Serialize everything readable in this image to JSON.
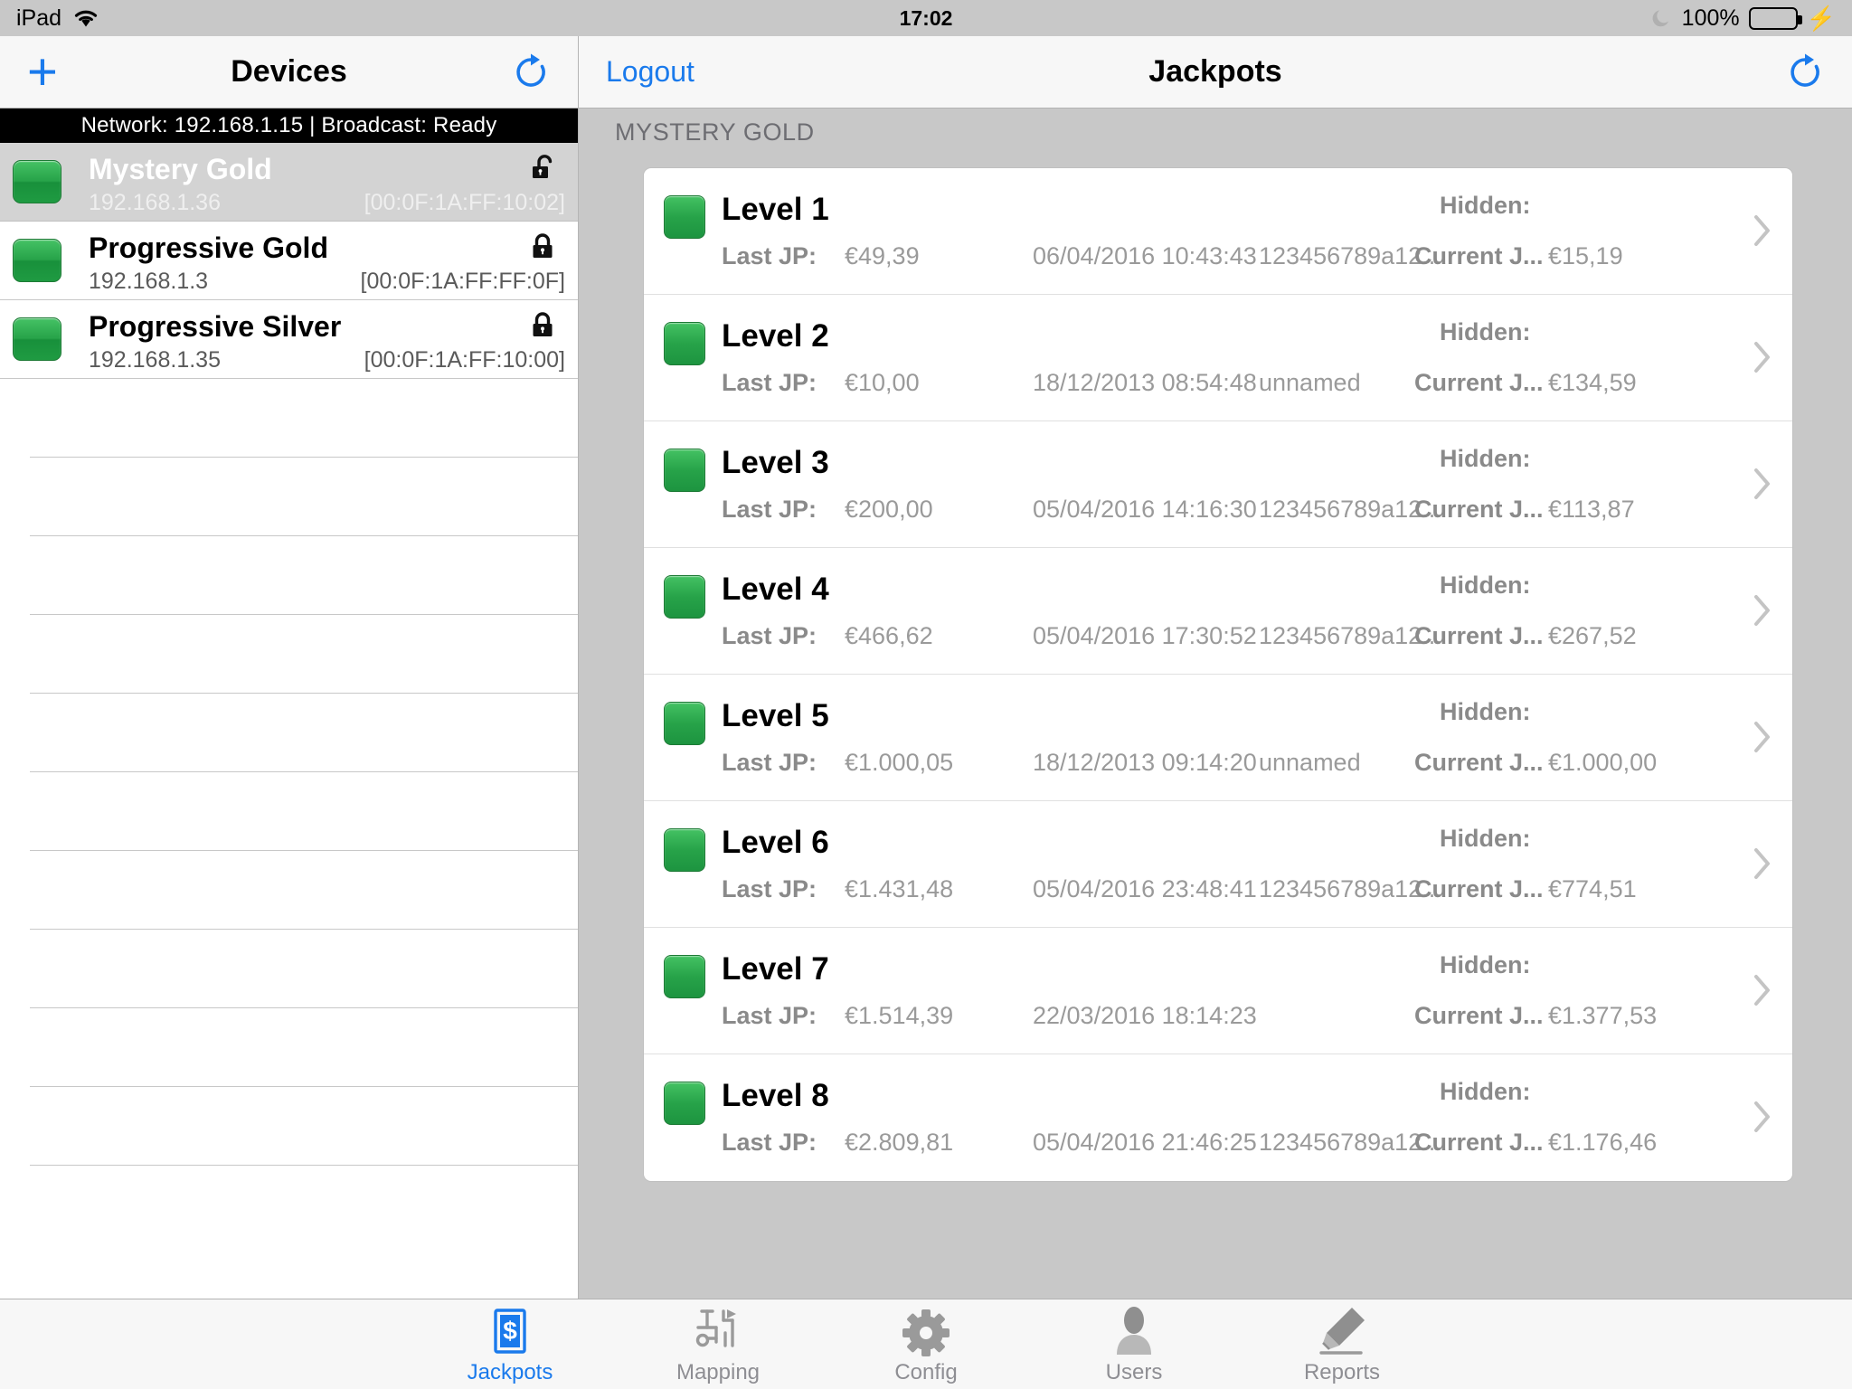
{
  "status_bar": {
    "device": "iPad",
    "wifi_icon": "wifi-icon",
    "time": "17:02",
    "dnd_icon": "moon-icon",
    "battery_percent": "100%",
    "battery_icon": "battery-icon",
    "charging_icon": "lightning-bolt-icon",
    "battery_color": "#4cd964"
  },
  "sidebar": {
    "nav": {
      "add_label": "+",
      "title": "Devices",
      "refresh_icon": "refresh-icon"
    },
    "network_banner": "Network: 192.168.1.15 | Broadcast: Ready",
    "devices": [
      {
        "name": "Mystery Gold",
        "ip": "192.168.1.36",
        "mac": "[00:0F:1A:FF:10:02]",
        "lock": "unlocked",
        "selected": true,
        "status_color": "#27a349"
      },
      {
        "name": "Progressive Gold",
        "ip": "192.168.1.3",
        "mac": "[00:0F:1A:FF:FF:0F]",
        "lock": "locked",
        "selected": false,
        "status_color": "#27a349"
      },
      {
        "name": "Progressive Silver",
        "ip": "192.168.1.35",
        "mac": "[00:0F:1A:FF:10:00]",
        "lock": "locked",
        "selected": false,
        "status_color": "#27a349"
      }
    ],
    "empty_row_count": 10
  },
  "detail": {
    "nav": {
      "logout_label": "Logout",
      "title": "Jackpots",
      "refresh_icon": "refresh-icon"
    },
    "section_header": "MYSTERY GOLD",
    "labels": {
      "last_jp": "Last JP:",
      "hidden": "Hidden:",
      "current_jp": "Current J..."
    },
    "jackpots": [
      {
        "level": "Level 1",
        "last_jp_value": "€49,39",
        "timestamp": "06/04/2016 10:43:43",
        "player": "123456789a12...",
        "current_jp_value": "€15,19"
      },
      {
        "level": "Level 2",
        "last_jp_value": "€10,00",
        "timestamp": "18/12/2013 08:54:48",
        "player": "unnamed",
        "current_jp_value": "€134,59"
      },
      {
        "level": "Level 3",
        "last_jp_value": "€200,00",
        "timestamp": "05/04/2016 14:16:30",
        "player": "123456789a12...",
        "current_jp_value": "€113,87"
      },
      {
        "level": "Level 4",
        "last_jp_value": "€466,62",
        "timestamp": "05/04/2016 17:30:52",
        "player": "123456789a12...",
        "current_jp_value": "€267,52"
      },
      {
        "level": "Level 5",
        "last_jp_value": "€1.000,05",
        "timestamp": "18/12/2013 09:14:20",
        "player": "unnamed",
        "current_jp_value": "€1.000,00"
      },
      {
        "level": "Level 6",
        "last_jp_value": "€1.431,48",
        "timestamp": "05/04/2016 23:48:41",
        "player": "123456789a12...",
        "current_jp_value": "€774,51"
      },
      {
        "level": "Level 7",
        "last_jp_value": "€1.514,39",
        "timestamp": "22/03/2016 18:14:23",
        "player": "",
        "current_jp_value": "€1.377,53"
      },
      {
        "level": "Level 8",
        "last_jp_value": "€2.809,81",
        "timestamp": "05/04/2016 21:46:25",
        "player": "123456789a12...",
        "current_jp_value": "€1.176,46"
      }
    ]
  },
  "tab_bar": {
    "active_color": "#1a7aec",
    "inactive_color": "#8e8e93",
    "tabs": [
      {
        "label": "Jackpots",
        "icon": "dollar-bill-icon",
        "active": true
      },
      {
        "label": "Mapping",
        "icon": "mapping-flow-icon",
        "active": false
      },
      {
        "label": "Config",
        "icon": "gear-icon",
        "active": false
      },
      {
        "label": "Users",
        "icon": "user-person-icon",
        "active": false
      },
      {
        "label": "Reports",
        "icon": "fountain-pen-icon",
        "active": false
      }
    ]
  }
}
